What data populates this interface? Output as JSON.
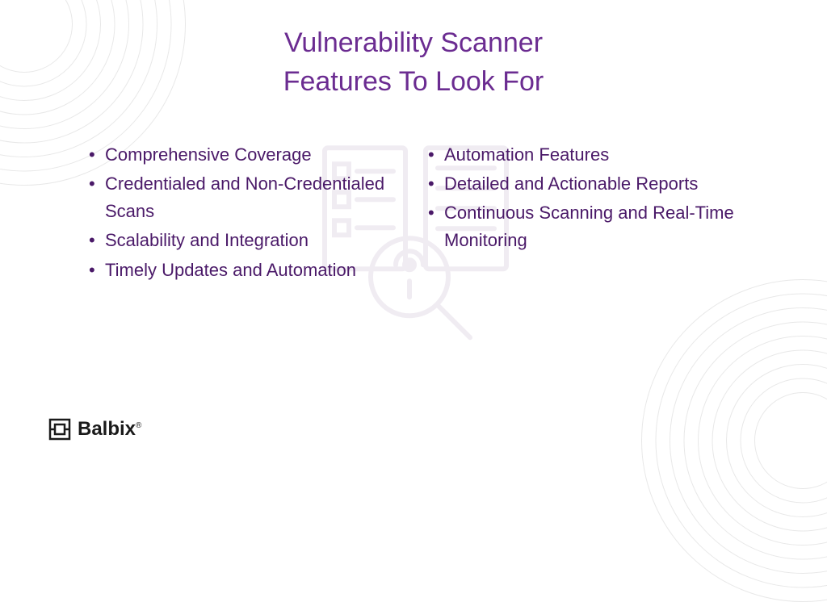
{
  "title": {
    "line1": "Vulnerability Scanner",
    "line2": "Features To Look For"
  },
  "features": {
    "left": [
      "Comprehensive Coverage",
      "Credentialed and Non-Credentialed Scans",
      "Scalability and Integration",
      "Timely Updates and Automation"
    ],
    "right": [
      "Automation Features",
      "Detailed and Actionable Reports",
      "Continuous Scanning and Real-Time Monitoring"
    ]
  },
  "brand": {
    "name": "Balbix"
  },
  "colors": {
    "primary": "#6b2c91",
    "text": "#4a1968",
    "circleStroke": "#e8e8e8"
  }
}
